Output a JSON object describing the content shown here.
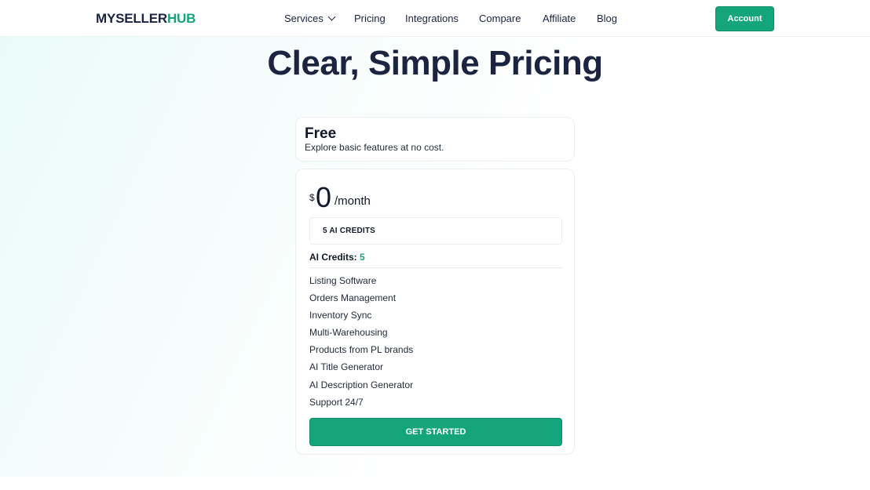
{
  "header": {
    "logo_main": "MYSELLER",
    "logo_accent": "HUB",
    "nav": [
      {
        "label": "Services",
        "has_dropdown": true
      },
      {
        "label": "Pricing"
      },
      {
        "label": "Integrations"
      },
      {
        "label": "Compare"
      },
      {
        "label": "Affiliate"
      },
      {
        "label": "Blog"
      }
    ],
    "account_label": "Account"
  },
  "main": {
    "title": "Clear, Simple Pricing",
    "plan": {
      "name": "Free",
      "description": "Explore basic features at no cost.",
      "currency": "$",
      "price": "0",
      "period": "/month",
      "credits_option": "5 AI CREDITS",
      "ai_credits_label": "AI Credits:",
      "ai_credits_value": "5",
      "features": [
        "Listing Software",
        "Orders Management",
        "Inventory Sync",
        "Multi-Warehousing",
        "Products from PL brands",
        "AI Title Generator",
        "AI Description Generator",
        "Support 24/7"
      ],
      "cta_label": "GET STARTED"
    }
  },
  "colors": {
    "brand": "#14a57c",
    "text": "#1b2440"
  }
}
